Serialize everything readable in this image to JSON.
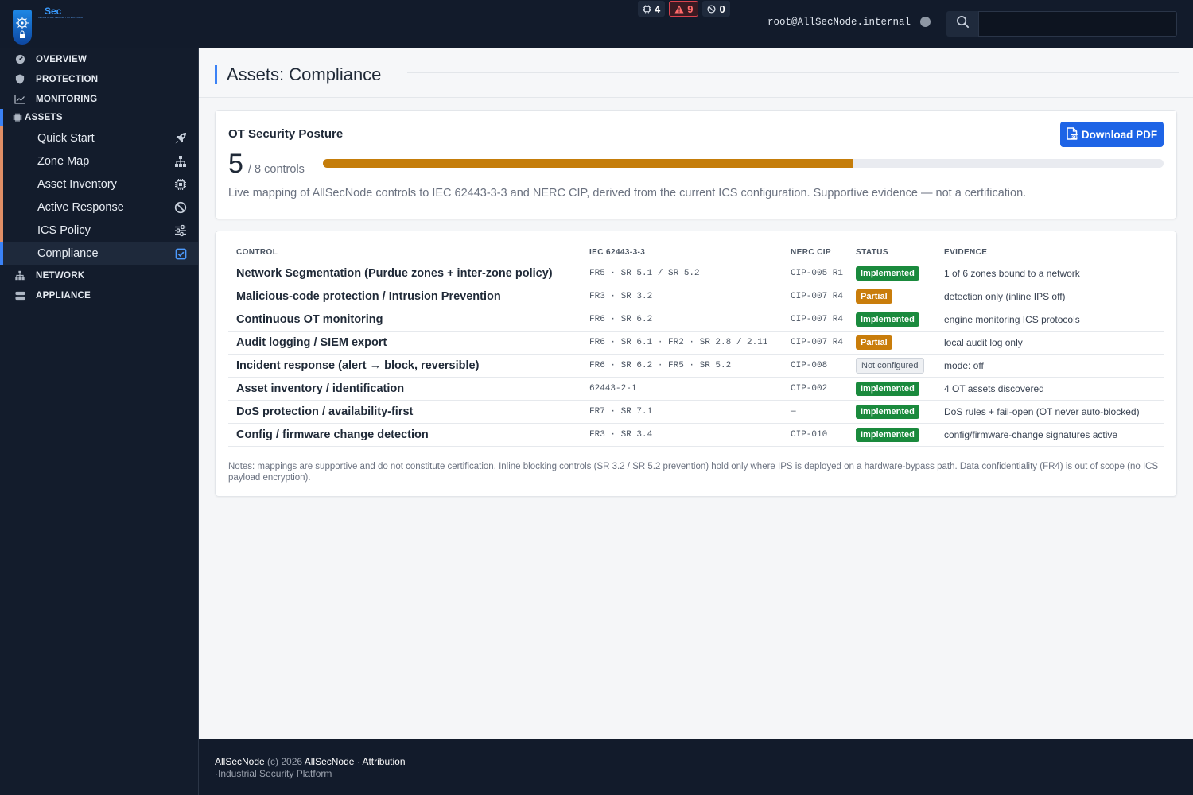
{
  "brand": {
    "name": "Sec",
    "tagline": "INDUSTRIAL SECURITY PLATFORM"
  },
  "header": {
    "badges": [
      {
        "icon": "chip-icon",
        "value": "4"
      },
      {
        "icon": "warning-icon",
        "value": "9"
      },
      {
        "icon": "block-icon",
        "value": "0"
      }
    ],
    "user": "root@AllSecNode.internal",
    "search_placeholder": ""
  },
  "sidebar": {
    "sections": {
      "overview": "OVERVIEW",
      "protection": "PROTECTION",
      "monitoring": "MONITORING",
      "assets": "ASSETS",
      "network": "NETWORK",
      "appliance": "APPLIANCE"
    },
    "assets_items": [
      {
        "label": "Quick Start",
        "icon": "rocket-icon"
      },
      {
        "label": "Zone Map",
        "icon": "sitemap-icon"
      },
      {
        "label": "Asset Inventory",
        "icon": "chip-icon"
      },
      {
        "label": "Active Response",
        "icon": "ban-icon"
      },
      {
        "label": "ICS Policy",
        "icon": "sliders-icon"
      },
      {
        "label": "Compliance",
        "icon": "checkbox-icon"
      }
    ]
  },
  "page": {
    "title": "Assets: Compliance"
  },
  "posture": {
    "title": "OT Security Posture",
    "score": "5",
    "total_label": "/ 8 controls",
    "progress": 0.63,
    "description": "Live mapping of AllSecNode controls to IEC 62443-3-3 and NERC CIP, derived from the current ICS configuration. Supportive evidence — not a certification.",
    "download_label": "Download PDF"
  },
  "table": {
    "headers": [
      "CONTROL",
      "IEC 62443-3-3",
      "NERC CIP",
      "STATUS",
      "EVIDENCE"
    ],
    "rows": [
      {
        "control": "Network Segmentation (Purdue zones + inter-zone policy)",
        "iec": "FR5 · SR 5.1 / SR 5.2",
        "nerc": "CIP-005 R1",
        "status": "Implemented",
        "evidence": "1 of 6 zones bound to a network"
      },
      {
        "control": "Malicious-code protection / Intrusion Prevention",
        "iec": "FR3 · SR 3.2",
        "nerc": "CIP-007 R4",
        "status": "Partial",
        "evidence": "detection only (inline IPS off)"
      },
      {
        "control": "Continuous OT monitoring",
        "iec": "FR6 · SR 6.2",
        "nerc": "CIP-007 R4",
        "status": "Implemented",
        "evidence": "engine monitoring ICS protocols"
      },
      {
        "control": "Audit logging / SIEM export",
        "iec": "FR6 · SR 6.1 · FR2 · SR 2.8 / 2.11",
        "nerc": "CIP-007 R4",
        "status": "Partial",
        "evidence": "local audit log only"
      },
      {
        "control": "Incident response (alert → block, reversible)",
        "iec": "FR6 · SR 6.2 · FR5 · SR 5.2",
        "nerc": "CIP-008",
        "status": "Not configured",
        "evidence": "mode: off"
      },
      {
        "control": "Asset inventory / identification",
        "iec": "62443-2-1",
        "nerc": "CIP-002",
        "status": "Implemented",
        "evidence": "4 OT assets discovered"
      },
      {
        "control": "DoS protection / availability-first",
        "iec": "FR7 · SR 7.1",
        "nerc": "—",
        "status": "Implemented",
        "evidence": "DoS rules + fail-open (OT never auto-blocked)"
      },
      {
        "control": "Config / firmware change detection",
        "iec": "FR3 · SR 3.4",
        "nerc": "CIP-010",
        "status": "Implemented",
        "evidence": "config/firmware-change signatures active"
      }
    ],
    "notes": "Notes: mappings are supportive and do not constitute certification. Inline blocking controls (SR 3.2 / SR 5.2 prevention) hold only where IPS is deployed on a hardware-bypass path. Data confidentiality (FR4) is out of scope (no ICS payload encryption)."
  },
  "footer": {
    "brand": "AllSecNode",
    "copyright": "(c) 2026",
    "owner": "AllSecNode",
    "sep": "·",
    "attribution": "Attribution",
    "tagline": "·Industrial Security Platform"
  },
  "colors": {
    "accent": "#3b82f6",
    "implemented": "#1a8a3d",
    "partial": "#c97d0b",
    "progress": "#c57d0a"
  }
}
